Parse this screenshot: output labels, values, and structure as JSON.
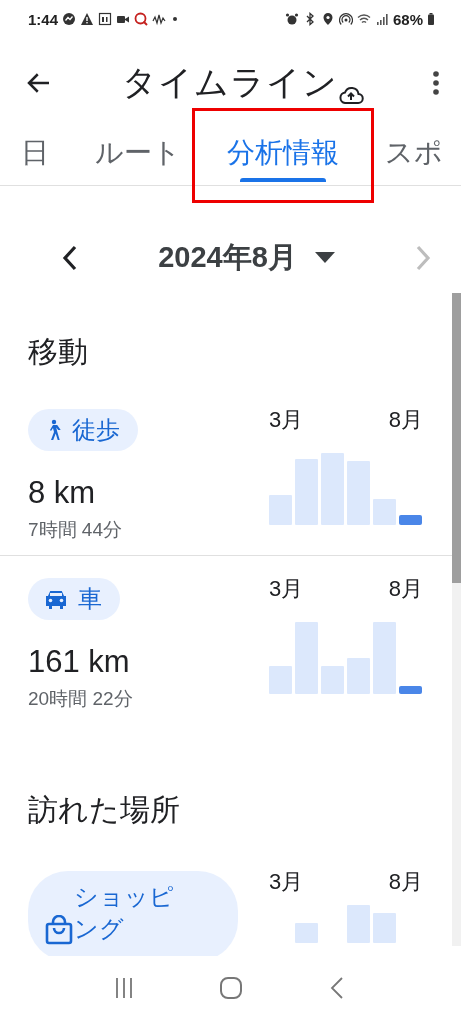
{
  "status_bar": {
    "time": "1:44",
    "battery": "68%"
  },
  "header": {
    "title": "タイムライン"
  },
  "tabs": [
    {
      "label": "日",
      "selected": false,
      "outlined": false
    },
    {
      "label": "ルート",
      "selected": false,
      "outlined": false
    },
    {
      "label": "分析情報",
      "selected": true,
      "outlined": true
    },
    {
      "label": "スポ",
      "selected": false,
      "outlined": false
    }
  ],
  "month_nav": {
    "label": "2024年8月",
    "next_disabled": true
  },
  "sections": [
    {
      "heading": "移動",
      "cards": [
        {
          "kind": "walk",
          "chip": "徒歩",
          "distance": "8 km",
          "duration": "7時間 44分",
          "chart": {
            "start": "3月",
            "end": "8月"
          }
        },
        {
          "kind": "car",
          "chip": "車",
          "distance": "161 km",
          "duration": "20時間 22分",
          "chart": {
            "start": "3月",
            "end": "8月"
          }
        }
      ]
    },
    {
      "heading": "訪れた場所",
      "cards": [
        {
          "kind": "shopping",
          "chip": "ショッピング",
          "chart": {
            "start": "3月",
            "end": "8月"
          }
        }
      ]
    }
  ]
}
